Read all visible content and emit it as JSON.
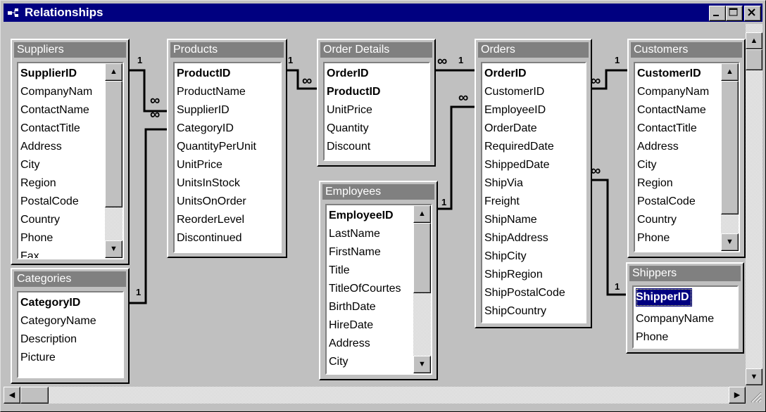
{
  "window": {
    "title": "Relationships",
    "minimize_icon": "minimize-icon",
    "maximize_icon": "maximize-icon",
    "close_icon": "close-icon"
  },
  "tables": {
    "suppliers": {
      "title": "Suppliers",
      "fields": [
        "SupplierID",
        "CompanyNam",
        "ContactName",
        "ContactTitle",
        "Address",
        "City",
        "Region",
        "PostalCode",
        "Country",
        "Phone",
        "Fax"
      ]
    },
    "categories": {
      "title": "Categories",
      "fields": [
        "CategoryID",
        "CategoryName",
        "Description",
        "Picture"
      ]
    },
    "products": {
      "title": "Products",
      "fields": [
        "ProductID",
        "ProductName",
        "SupplierID",
        "CategoryID",
        "QuantityPerUnit",
        "UnitPrice",
        "UnitsInStock",
        "UnitsOnOrder",
        "ReorderLevel",
        "Discontinued"
      ]
    },
    "order_details": {
      "title": "Order Details",
      "fields": [
        "OrderID",
        "ProductID",
        "UnitPrice",
        "Quantity",
        "Discount"
      ]
    },
    "employees": {
      "title": "Employees",
      "fields": [
        "EmployeeID",
        "LastName",
        "FirstName",
        "Title",
        "TitleOfCourtes",
        "BirthDate",
        "HireDate",
        "Address",
        "City"
      ]
    },
    "orders": {
      "title": "Orders",
      "fields": [
        "OrderID",
        "CustomerID",
        "EmployeeID",
        "OrderDate",
        "RequiredDate",
        "ShippedDate",
        "ShipVia",
        "Freight",
        "ShipName",
        "ShipAddress",
        "ShipCity",
        "ShipRegion",
        "ShipPostalCode",
        "ShipCountry"
      ]
    },
    "customers": {
      "title": "Customers",
      "fields": [
        "CustomerID",
        "CompanyNam",
        "ContactName",
        "ContactTitle",
        "Address",
        "City",
        "Region",
        "PostalCode",
        "Country",
        "Phone"
      ]
    },
    "shippers": {
      "title": "Shippers",
      "fields": [
        "ShipperID",
        "CompanyName",
        "Phone"
      ]
    }
  },
  "relationship_labels": {
    "one": "1",
    "many": "∞"
  },
  "colors": {
    "title_bar": "#000080",
    "table_title": "#808080",
    "selection": "#000080"
  }
}
